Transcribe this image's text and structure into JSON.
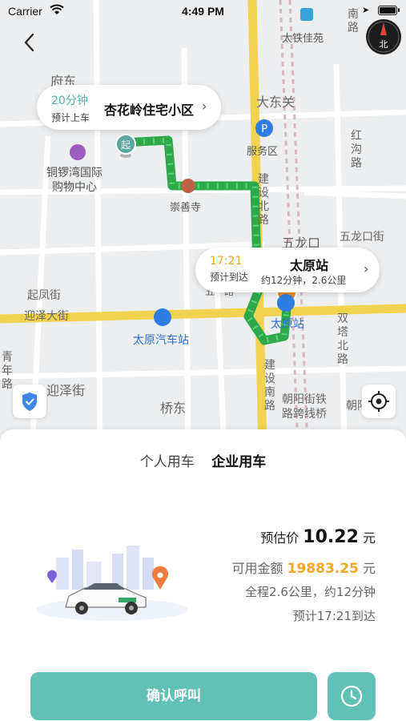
{
  "status_bar": {
    "carrier": "Carrier",
    "time": "4:49 PM"
  },
  "compass": {
    "label": "北"
  },
  "map": {
    "labels": {
      "fudong": "府东",
      "dadongguan": "大东关",
      "taitie_jiayuan": "太铁佳苑",
      "nanlu": "南路",
      "fuwuqu": "服务区",
      "honggoulu": "红沟路",
      "tongluowan": "铜锣湾国际\n购物中心",
      "chongshansi": "崇善寺",
      "jianshe_beilu": "建设北路",
      "wulongkou": "五龙口",
      "wulongkou_street": "五龙口街",
      "qifengjie": "起凤街",
      "yingze_dajie": "迎泽大街",
      "taiyuan_bus_station": "太原汽车站",
      "taiyuan_station_map": "太原站",
      "shuangta_beilu": "双塔北路",
      "qingnianlu": "青年路",
      "yingzejie": "迎泽街",
      "qiaodong": "桥东",
      "jianshe_nanlu": "建设南路",
      "chaoyangjie_bridge": "朝阳街铁\n路跨线桥",
      "chao": "朝阳",
      "wuyi": "五一路",
      "start_marker": "起",
      "end_marker": "终"
    }
  },
  "pickup_bubble": {
    "minutes": "20分钟",
    "subtitle": "预计上车",
    "place": "杏花岭住宅小区"
  },
  "dest_bubble": {
    "time": "17:21",
    "subtitle": "预计到达",
    "place": "太原站",
    "detail": "约12分钟，2.6公里"
  },
  "tabs": [
    {
      "label": "个人用车",
      "active": false
    },
    {
      "label": "企业用车",
      "active": true
    }
  ],
  "fare": {
    "estimate_label": "预估价",
    "estimate_value": "10.22",
    "unit": "元",
    "available_label": "可用金额",
    "available_value": "19883.25",
    "route_summary": "全程2.6公里，约12分钟",
    "arrival_estimate": "预计17:21到达"
  },
  "confirm_button": {
    "label": "确认呼叫"
  },
  "colors": {
    "accent": "#62c1b6",
    "route": "#3dbf5e",
    "highlight": "#f5a623",
    "major_road": "#f2d34f"
  }
}
